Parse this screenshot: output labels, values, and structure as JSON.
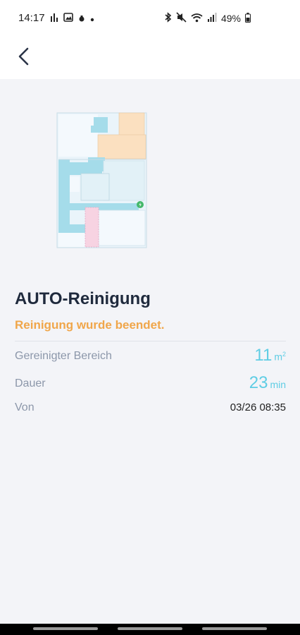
{
  "status_bar": {
    "time": "14:17",
    "battery": "49%"
  },
  "header": {
    "back_icon": "chevron-left-icon"
  },
  "map": {
    "room_colors": {
      "blue": "#a5dcea",
      "orange": "#fbe0c0",
      "pink": "#f7d3e2",
      "light": "#eaf4fa"
    },
    "dock_color": "#44b86a"
  },
  "cleaning": {
    "title": "AUTO-Reinigung",
    "status": "Reinigung wurde beendet.",
    "rows": [
      {
        "label": "Gereinigter Bereich",
        "value": "11",
        "unit": "m",
        "unit_sup": "2"
      },
      {
        "label": "Dauer",
        "value": "23",
        "unit": "min"
      },
      {
        "label": "Von",
        "value": "03/26 08:35"
      }
    ]
  },
  "colors": {
    "accent": "#5fcde4",
    "status": "#f0a64a",
    "title": "#1f2a3d",
    "label": "#8c97aa"
  }
}
